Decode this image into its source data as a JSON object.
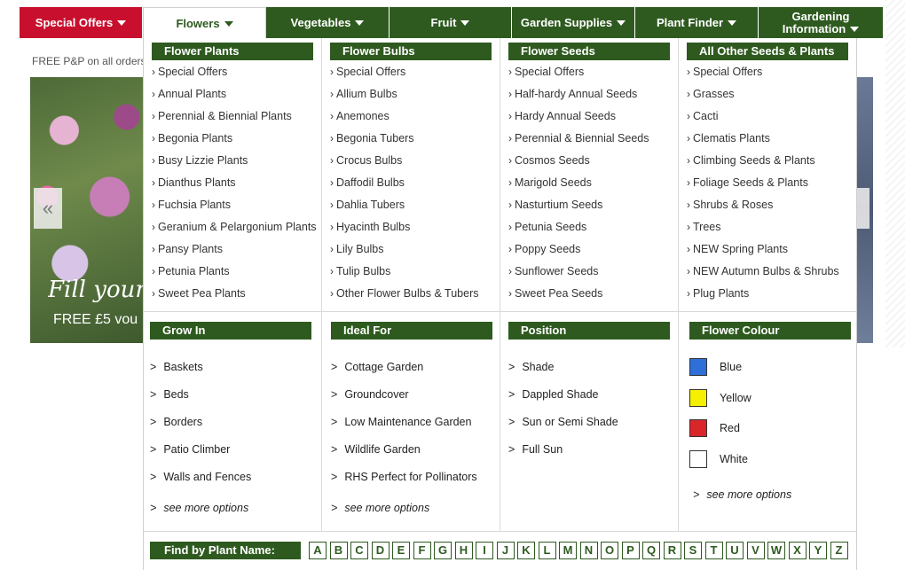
{
  "background": {
    "promo_text": "FREE P&P on all orders",
    "hero_title": "Fill your",
    "hero_subtitle": "FREE £5 vou",
    "prev_arrow": "«"
  },
  "nav": [
    {
      "label": "Special Offers",
      "active": false
    },
    {
      "label": "Flowers",
      "active": true
    },
    {
      "label": "Vegetables",
      "active": false
    },
    {
      "label": "Fruit",
      "active": false
    },
    {
      "label": "Garden Supplies",
      "active": false
    },
    {
      "label": "Plant Finder",
      "active": false
    },
    {
      "label_line1": "Gardening",
      "label_line2": "Information",
      "active": false
    }
  ],
  "columns": [
    {
      "heading": "Flower Plants",
      "items": [
        "Special Offers",
        "Annual Plants",
        "Perennial & Biennial Plants",
        "Begonia Plants",
        "Busy Lizzie Plants",
        "Dianthus Plants",
        "Fuchsia Plants",
        "Geranium & Pelargonium Plants",
        "Pansy Plants",
        "Petunia Plants",
        "Sweet Pea Plants"
      ]
    },
    {
      "heading": "Flower Bulbs",
      "items": [
        "Special Offers",
        "Allium Bulbs",
        "Anemones",
        "Begonia Tubers",
        "Crocus Bulbs",
        "Daffodil Bulbs",
        "Dahlia Tubers",
        "Hyacinth Bulbs",
        "Lily Bulbs",
        "Tulip Bulbs",
        "Other Flower Bulbs & Tubers"
      ]
    },
    {
      "heading": "Flower Seeds",
      "items": [
        "Special Offers",
        "Half-hardy Annual Seeds",
        "Hardy Annual Seeds",
        "Perennial & Biennial Seeds",
        "Cosmos Seeds",
        "Marigold Seeds",
        "Nasturtium Seeds",
        "Petunia Seeds",
        "Poppy Seeds",
        "Sunflower Seeds",
        "Sweet Pea Seeds"
      ]
    },
    {
      "heading": "All Other Seeds & Plants",
      "items": [
        "Special Offers",
        "Grasses",
        "Cacti",
        "Clematis Plants",
        "Climbing Seeds & Plants",
        "Foliage Seeds & Plants",
        "Shrubs & Roses",
        "Trees",
        "NEW Spring Plants",
        "NEW Autumn Bulbs & Shrubs",
        "Plug Plants"
      ]
    }
  ],
  "filters": [
    {
      "heading": "Grow In",
      "items": [
        "Baskets",
        "Beds",
        "Borders",
        "Patio Climber",
        "Walls and Fences"
      ],
      "more": "see more options"
    },
    {
      "heading": "Ideal For",
      "items": [
        "Cottage Garden",
        "Groundcover",
        "Low Maintenance Garden",
        "Wildlife Garden",
        "RHS Perfect for Pollinators"
      ],
      "more": "see more options"
    },
    {
      "heading": "Position",
      "items": [
        "Shade",
        "Dappled Shade",
        "Sun or Semi Shade",
        "Full Sun"
      ],
      "more": ""
    }
  ],
  "flower_colour": {
    "heading": "Flower Colour",
    "colours": [
      {
        "label": "Blue",
        "hex": "#2f6fd8"
      },
      {
        "label": "Yellow",
        "hex": "#f5f000"
      },
      {
        "label": "Red",
        "hex": "#d9262a"
      },
      {
        "label": "White",
        "hex": "#ffffff"
      }
    ],
    "more": "see more options"
  },
  "find_by_name": {
    "label": "Find by Plant Name:",
    "letters": [
      "A",
      "B",
      "C",
      "D",
      "E",
      "F",
      "G",
      "H",
      "I",
      "J",
      "K",
      "L",
      "M",
      "N",
      "O",
      "P",
      "Q",
      "R",
      "S",
      "T",
      "U",
      "V",
      "W",
      "X",
      "Y",
      "Z"
    ]
  },
  "colors": {
    "green": "#2e5a1f",
    "red": "#c8102e"
  }
}
